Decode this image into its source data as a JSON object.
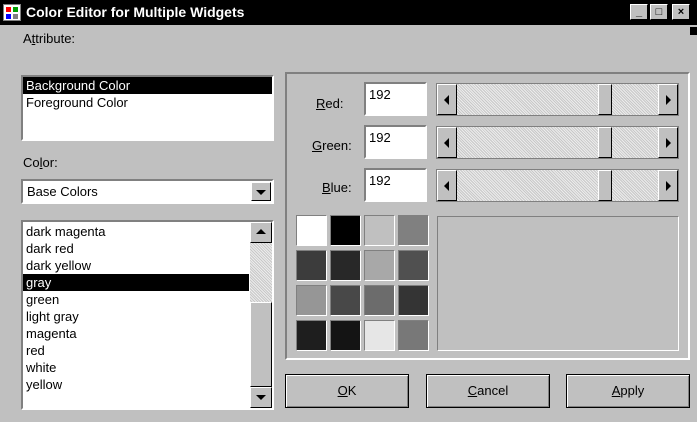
{
  "window": {
    "title": "Color Editor for Multiple Widgets",
    "minimize_glyph": "_",
    "maximize_glyph": "□",
    "close_glyph": "×",
    "icon": "app-icon"
  },
  "attribute": {
    "label_pre": "A",
    "label_underlined": "t",
    "label_post": "tribute:",
    "items": [
      "Background Color",
      "Foreground Color"
    ],
    "selected_index": 0
  },
  "color": {
    "label_pre": "Co",
    "label_underlined": "l",
    "label_post": "or:",
    "dropdown_value": "Base Colors",
    "items": [
      "dark magenta",
      "dark red",
      "dark yellow",
      "gray",
      "green",
      "light gray",
      "magenta",
      "red",
      "white",
      "yellow"
    ],
    "selected_index": 3
  },
  "rgb": {
    "red": {
      "label_underlined": "R",
      "label_post": "ed:",
      "value": "192",
      "fraction": 0.753
    },
    "green": {
      "label_underlined": "G",
      "label_post": "reen:",
      "value": "192",
      "fraction": 0.753
    },
    "blue": {
      "label_underlined": "B",
      "label_post": "lue:",
      "value": "192",
      "fraction": 0.753
    }
  },
  "swatches": [
    "#ffffff",
    "#000000",
    "#c0c0c0",
    "#808080",
    "#3c3c3c",
    "#282828",
    "#a8a8a8",
    "#505050",
    "#969696",
    "#484848",
    "#6c6c6c",
    "#343434",
    "#1e1e1e",
    "#141414",
    "#e6e6e6",
    "#787878"
  ],
  "preview_color": "#c0c0c0",
  "buttons": {
    "ok": {
      "underlined": "O",
      "rest": "K"
    },
    "cancel": {
      "underlined": "C",
      "rest": "ancel"
    },
    "apply": {
      "underlined": "A",
      "rest": "pply"
    }
  }
}
